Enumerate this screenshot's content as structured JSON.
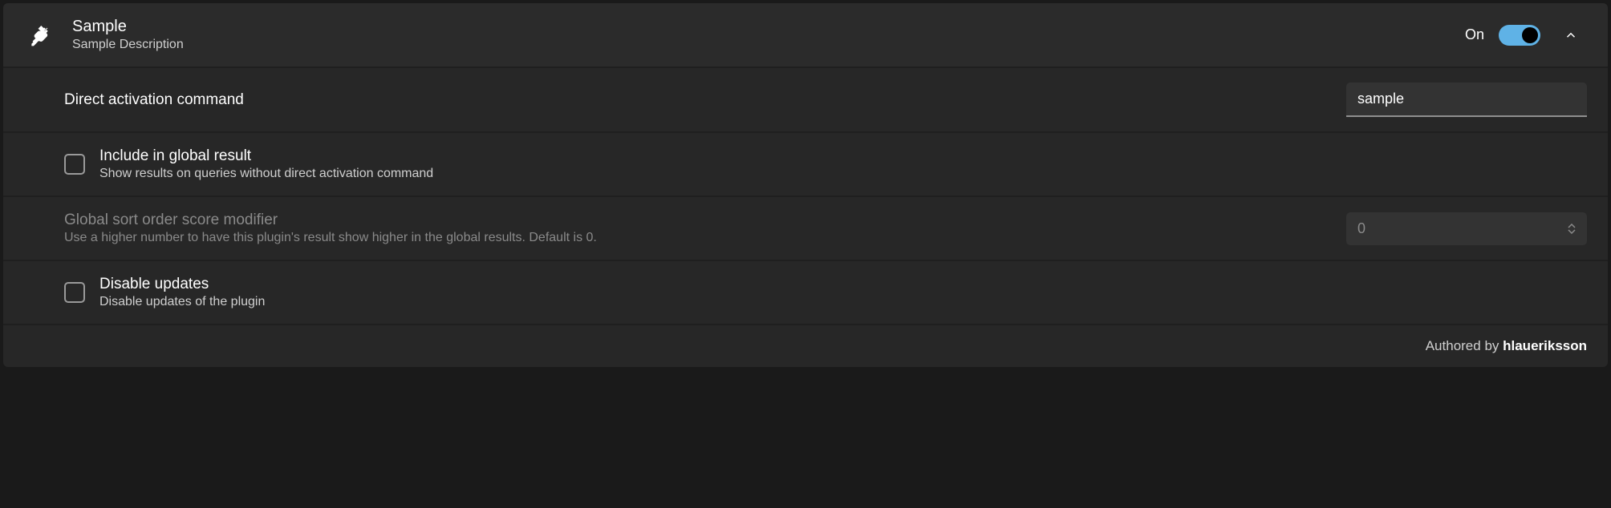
{
  "header": {
    "title": "Sample",
    "subtitle": "Sample Description",
    "toggle_label": "On",
    "toggle_state": true
  },
  "rows": {
    "activation": {
      "label": "Direct activation command",
      "value": "sample"
    },
    "global_result": {
      "label": "Include in global result",
      "desc": "Show results on queries without direct activation command",
      "checked": false
    },
    "sort_order": {
      "label": "Global sort order score modifier",
      "desc": "Use a higher number to have this plugin's result show higher in the global results. Default is 0.",
      "value": "0"
    },
    "disable_updates": {
      "label": "Disable updates",
      "desc": "Disable updates of the plugin",
      "checked": false
    }
  },
  "footer": {
    "prefix": "Authored by ",
    "author": "hlaueriksson"
  }
}
